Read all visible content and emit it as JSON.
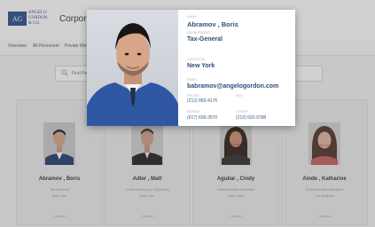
{
  "header": {
    "logo_mark": "AG",
    "logo_lines": [
      "ANGELO",
      "GORDON",
      "& CO."
    ],
    "app_title": "Corporate"
  },
  "nav": {
    "items": [
      "Overview",
      "All Personnel",
      "Private Wealth"
    ]
  },
  "search": {
    "placeholder": "Find Peers"
  },
  "popup": {
    "name_label": "NAME",
    "name": "Abramov , Boris",
    "department_label": "DEPARTMENT",
    "department": "Tax-General",
    "location_label": "LOCATION",
    "location": "New York",
    "email_label": "EMAIL",
    "email": "babramov@angelogordon.com",
    "phone_label": "PHONE",
    "phone": "(212) 883-4176",
    "fax_label": "FAX",
    "fax": "",
    "mobile_label": "MOBILE",
    "mobile": "(917) 699-3570",
    "other_label": "OTHER",
    "other": "(212) 692-9788"
  },
  "cards": [
    {
      "name": "Abramov , Boris",
      "line1": "Tax-General",
      "line2": "New York",
      "action": "Contact"
    },
    {
      "name": "Adler , Matt",
      "line1": "Credit Advisory & Reporting",
      "line2": "New York",
      "action": "Contact"
    },
    {
      "name": "Aguilar , Cindy",
      "line1": "Administrative Assistant",
      "line2": "New York",
      "action": "Contact"
    },
    {
      "name": "Ainde , Katharine",
      "line1": "Administrative Assistant",
      "line2": "Los Angeles",
      "action": "Contact"
    }
  ]
}
